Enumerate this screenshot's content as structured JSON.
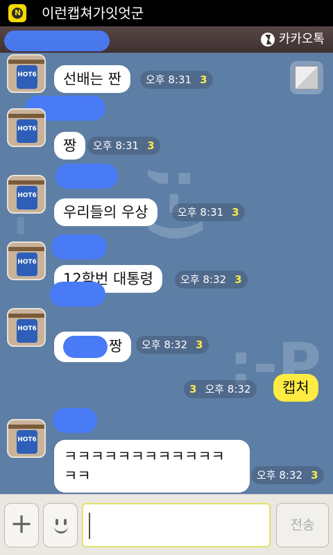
{
  "status_bar": {
    "notification_icon": "kakao-n-icon",
    "notification_letter": "N",
    "title": "이런캡쳐가잇엇군"
  },
  "title_bar": {
    "brand_icon": "kakaotalk-bolt-icon",
    "brand": "카카오톡"
  },
  "colors": {
    "mine_bubble": "#ffec42",
    "other_bubble": "#ffffff",
    "unread": "#ffe84a",
    "chat_bg": "#5d7ea5"
  },
  "messages": [
    {
      "sender": "other",
      "text": "선배는 짠",
      "time": "오후 8:31",
      "unread": "3"
    },
    {
      "sender": "other",
      "text": "짱",
      "time": "오후 8:31",
      "unread": "3"
    },
    {
      "sender": "other",
      "text": "우리들의 우상",
      "time": "오후 8:31",
      "unread": "3"
    },
    {
      "sender": "other",
      "text": "12학번 대통령",
      "time": "오후 8:32",
      "unread": "3"
    },
    {
      "sender": "other",
      "text": "짱",
      "time": "오후 8:32",
      "unread": "3"
    },
    {
      "sender": "me",
      "text": "캡처",
      "time": "오후 8:32",
      "unread": "3"
    },
    {
      "sender": "other",
      "text": "ㅋㅋㅋㅋㅋㅋㅋㅋㅋㅋㅋㅋ\nㅋㅋ",
      "time": "오후 8:32",
      "unread": "3"
    }
  ],
  "avatar_label": "HOT6",
  "input_bar": {
    "plus_icon": "plus-icon",
    "emoji_icon": "emoticon-icon",
    "message_value": "",
    "send_label": "전송"
  }
}
